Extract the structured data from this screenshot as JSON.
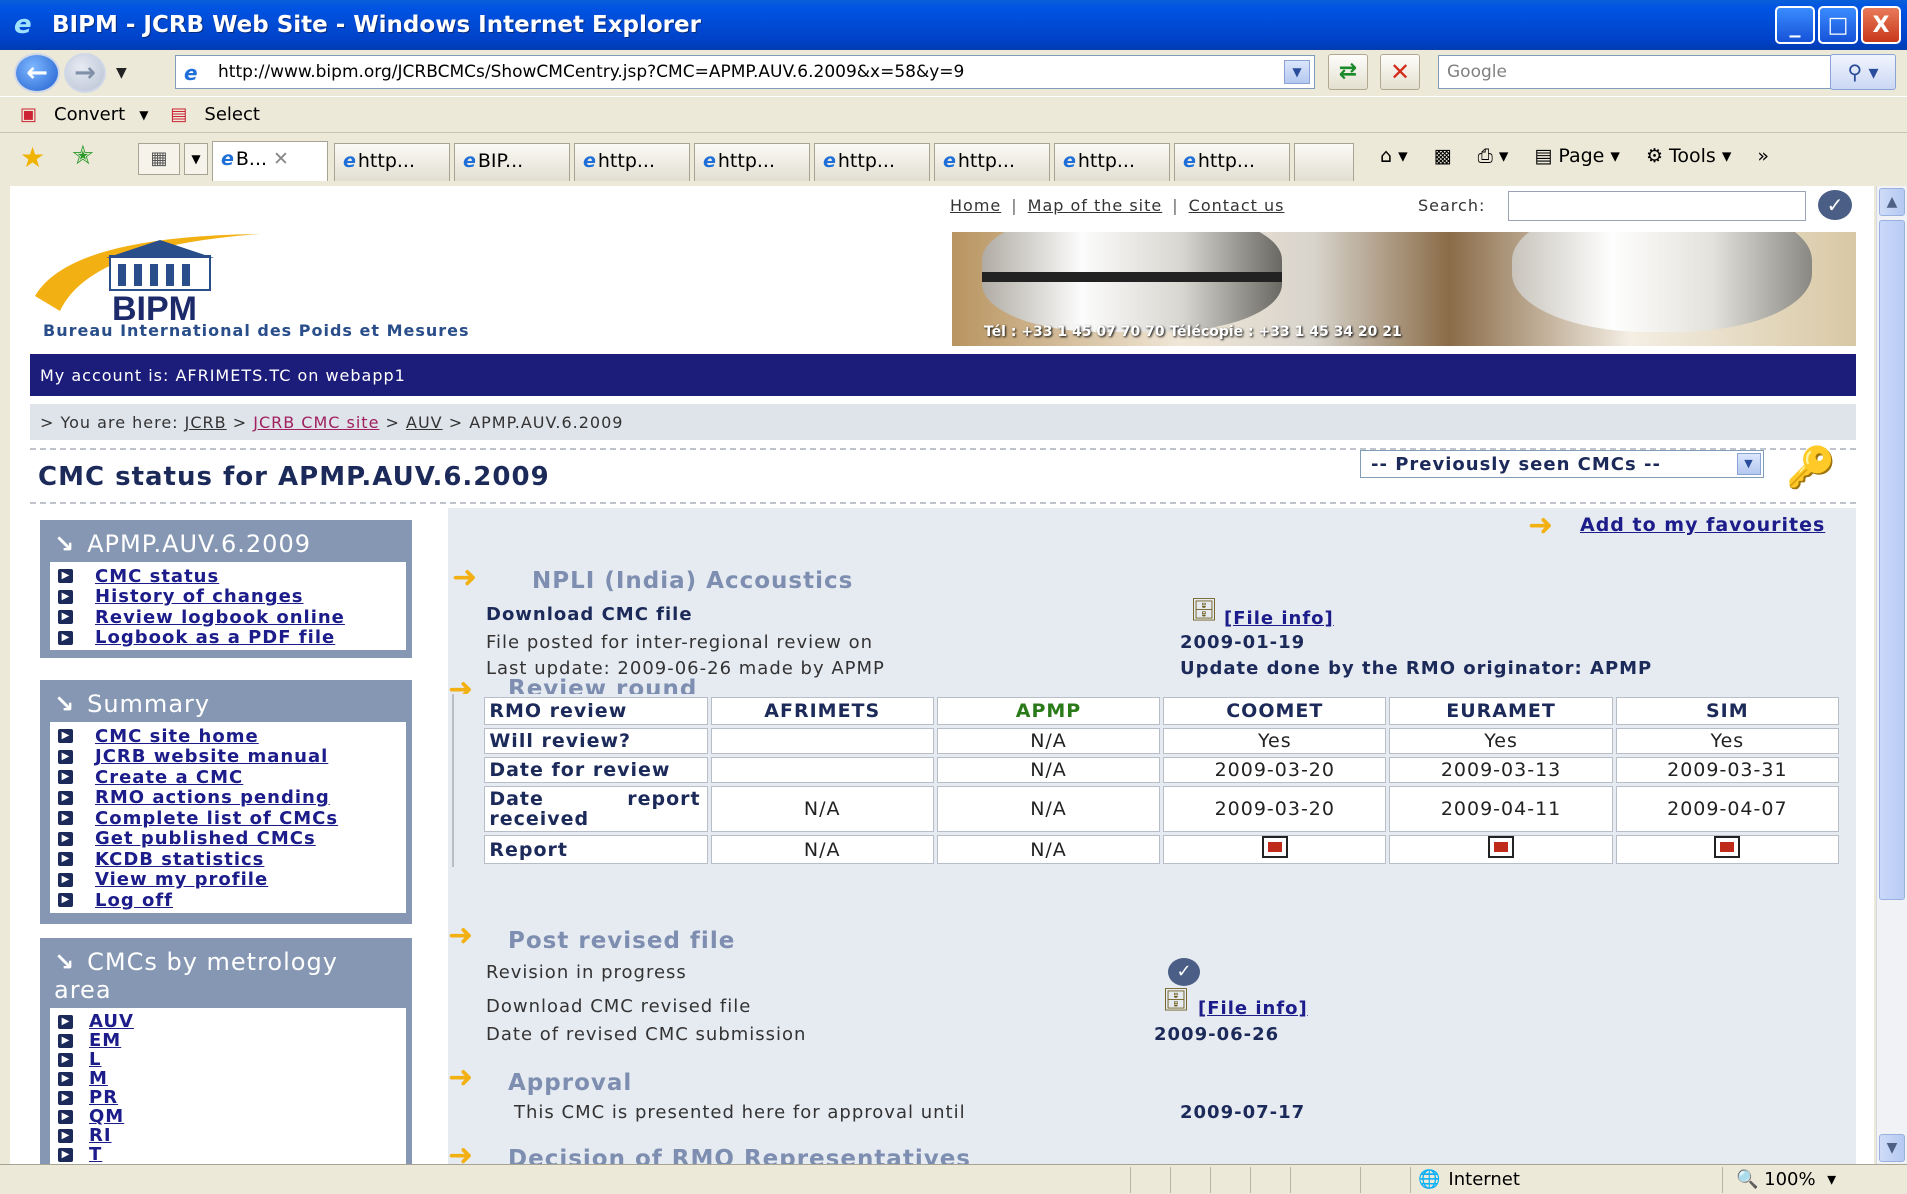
{
  "window": {
    "title": "BIPM - JCRB Web Site - Windows Internet Explorer",
    "min": "_",
    "max": "□",
    "close": "X"
  },
  "address": {
    "url": "http://www.bipm.org/JCRBCMCs/ShowCMCentry.jsp?CMC=APMP.AUV.6.2009&x=58&y=9",
    "search_placeholder": "Google"
  },
  "cmdbar": {
    "convert": "Convert",
    "select": "Select"
  },
  "tabs": [
    {
      "label": "B..."
    },
    {
      "label": "http..."
    },
    {
      "label": "BIP..."
    },
    {
      "label": "http..."
    },
    {
      "label": "http..."
    },
    {
      "label": "http..."
    },
    {
      "label": "http..."
    },
    {
      "label": "http..."
    },
    {
      "label": "http..."
    }
  ],
  "rightcmds": {
    "page": "Page",
    "tools": "Tools"
  },
  "site": {
    "toplinks": {
      "home": "Home",
      "map": "Map of the site",
      "contact": "Contact us",
      "search_label": "Search:"
    },
    "logo_word": "BIPM",
    "logo_subtitle": "Bureau International des Poids et Mesures",
    "banner_phone": "Tél : +33 1 45 07 70 70  Télécopie : +33 1 45 34 20 21",
    "account": "My account is: AFRIMETS.TC on webapp1",
    "breadcrumb": {
      "prefix": "> You are here:",
      "jcrb": "JCRB",
      "cmc_site": "JCRB CMC site",
      "auv": "AUV",
      "current": "APMP.AUV.6.2009"
    },
    "page_title": "CMC status for APMP.AUV.6.2009",
    "prev_select": "-- Previously seen CMCs --"
  },
  "sidebar": {
    "box1": {
      "title": "APMP.AUV.6.2009",
      "items": [
        "CMC status",
        "History of changes",
        "Review logbook online",
        "Logbook as a PDF file"
      ]
    },
    "box2": {
      "title": "Summary",
      "items": [
        "CMC site home",
        "JCRB website manual",
        "Create a CMC",
        "RMO actions pending",
        "Complete list of CMCs",
        "Get published CMCs",
        "KCDB statistics",
        "View my profile",
        "Log off"
      ]
    },
    "box3": {
      "title_line1": "CMCs by metrology",
      "title_line2": "area",
      "items": [
        "AUV",
        "EM",
        "L",
        "M",
        "PR",
        "QM",
        "RI",
        "T"
      ]
    }
  },
  "main": {
    "favourites": "Add to my favourites",
    "section1": {
      "title": "NPLI (India) Accoustics",
      "download": "Download CMC file",
      "file_info": "[File info]",
      "posted_label": "File posted for inter-regional review on",
      "posted_date": "2009-01-19",
      "last_update": "Last update: 2009-06-26 made by APMP",
      "update_by": "Update done by the RMO originator: APMP"
    },
    "review": {
      "title": "Review round",
      "columns": [
        "RMO review",
        "AFRIMETS",
        "APMP",
        "COOMET",
        "EURAMET",
        "SIM"
      ],
      "rows": [
        {
          "label": "Will review?",
          "cells": [
            "",
            "N/A",
            "Yes",
            "Yes",
            "Yes"
          ]
        },
        {
          "label": "Date for review",
          "cells": [
            "",
            "N/A",
            "2009-03-20",
            "2009-03-13",
            "2009-03-31"
          ]
        },
        {
          "label_a": "Date",
          "label_b": "report",
          "label_c": "received",
          "cells": [
            "N/A",
            "N/A",
            "2009-03-20",
            "2009-04-11",
            "2009-04-07"
          ]
        },
        {
          "label": "Report",
          "cells": [
            "N/A",
            "N/A",
            "pdf-icon",
            "pdf-icon",
            "pdf-icon"
          ]
        }
      ]
    },
    "revised": {
      "title": "Post revised file",
      "progress": "Revision in progress",
      "download": "Download CMC revised file",
      "file_info": "[File info]",
      "date_label": "Date of revised CMC submission",
      "date": "2009-06-26"
    },
    "approval": {
      "title": "Approval",
      "text": "This CMC is presented here for approval until",
      "date": "2009-07-17"
    },
    "decision": {
      "title": "Decision of RMO Representatives"
    }
  },
  "status": {
    "zone": "Internet",
    "zoom": "100%"
  }
}
